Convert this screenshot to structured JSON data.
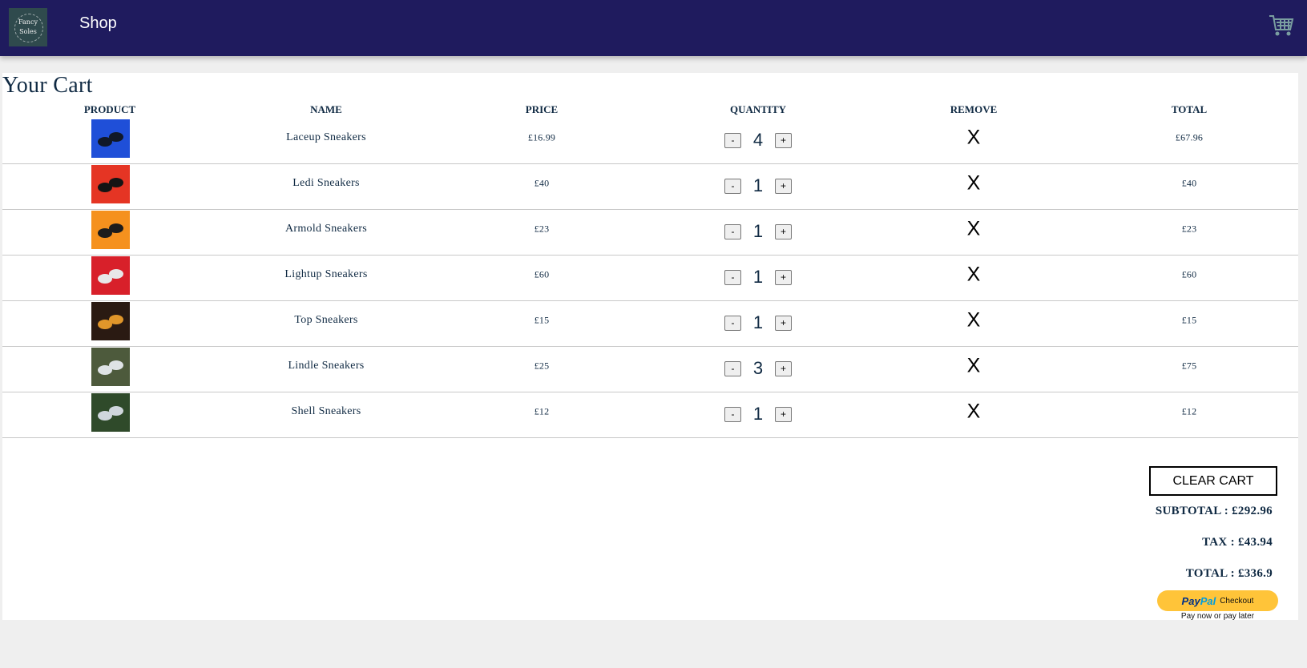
{
  "nav": {
    "logo_line1": "Fancy",
    "logo_line2": "Soles",
    "shop_label": "Shop"
  },
  "cart": {
    "title": "Your Cart",
    "columns": {
      "product": "PRODUCT",
      "name": "NAME",
      "price": "PRICE",
      "quantity": "QUANTITY",
      "remove": "REMOVE",
      "total": "TOTAL"
    },
    "items": [
      {
        "name": "Laceup Sneakers",
        "price": "£16.99",
        "qty": "4",
        "remove": "X",
        "total": "£67.96",
        "thumb_bg": "#1f4fd8",
        "thumb_fg": "#101828"
      },
      {
        "name": "Ledi Sneakers",
        "price": "£40",
        "qty": "1",
        "remove": "X",
        "total": "£40",
        "thumb_bg": "#e53524",
        "thumb_fg": "#141414"
      },
      {
        "name": "Armold Sneakers",
        "price": "£23",
        "qty": "1",
        "remove": "X",
        "total": "£23",
        "thumb_bg": "#f5911e",
        "thumb_fg": "#1c1c1c"
      },
      {
        "name": "Lightup Sneakers",
        "price": "£60",
        "qty": "1",
        "remove": "X",
        "total": "£60",
        "thumb_bg": "#d8202a",
        "thumb_fg": "#e8e8e8"
      },
      {
        "name": "Top Sneakers",
        "price": "£15",
        "qty": "1",
        "remove": "X",
        "total": "£15",
        "thumb_bg": "#2a1a12",
        "thumb_fg": "#e0962a"
      },
      {
        "name": "Lindle Sneakers",
        "price": "£25",
        "qty": "3",
        "remove": "X",
        "total": "£75",
        "thumb_bg": "#4d5a3c",
        "thumb_fg": "#dfe3e6"
      },
      {
        "name": "Shell Sneakers",
        "price": "£12",
        "qty": "1",
        "remove": "X",
        "total": "£12",
        "thumb_bg": "#2f4a2a",
        "thumb_fg": "#cfd6dc"
      }
    ],
    "qty_minus": "-",
    "qty_plus": "+",
    "clear_label": "CLEAR CART",
    "subtotal": "SUBTOTAL : £292.96",
    "tax": "TAX : £43.94",
    "total": "TOTAL : £336.9"
  },
  "paypal": {
    "logo_pay": "Pay",
    "logo_pal": "Pal",
    "label": "Checkout",
    "tagline": "Pay now or pay later"
  },
  "colors": {
    "navbar": "#1f1b5e",
    "paypal_button": "#ffc439",
    "text": "#102a43"
  }
}
